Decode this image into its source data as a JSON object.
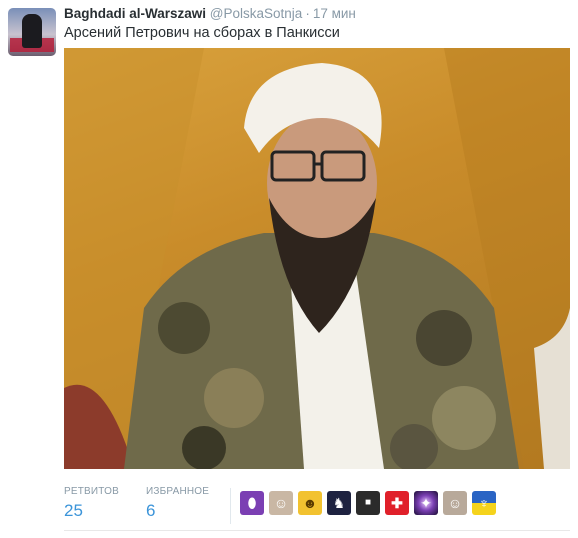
{
  "tweet": {
    "fullname": "Baghdadi al-Warszawi",
    "username": "@PolskaSotnja",
    "separator": "·",
    "time": "17 мин",
    "text": "Арсений Петрович на сборах в Панкисси"
  },
  "stats": {
    "retweets_label": "РЕТВИТОВ",
    "retweets_value": "25",
    "favorites_label": "ИЗБРАННОЕ",
    "favorites_value": "6"
  },
  "favoriters": [
    {
      "icon": "purple-oval-avatar-icon",
      "color": "#7b3fb3"
    },
    {
      "icon": "person-portrait-avatar-icon",
      "color": "#c9b7a4"
    },
    {
      "icon": "yellow-cartoon-avatar-icon",
      "color": "#f2c230"
    },
    {
      "icon": "dark-figure-avatar-icon",
      "color": "#1e2240"
    },
    {
      "icon": "dark-logo-avatar-icon",
      "color": "#2b2b2b"
    },
    {
      "icon": "swiss-cross-avatar-icon",
      "color": "#e0202a"
    },
    {
      "icon": "galaxy-avatar-icon",
      "color": "#5a2a8a"
    },
    {
      "icon": "man-portrait-avatar-icon",
      "color": "#b8a99a"
    },
    {
      "icon": "ukraine-coat-of-arms-avatar-icon",
      "color": "#2a64c4"
    }
  ]
}
